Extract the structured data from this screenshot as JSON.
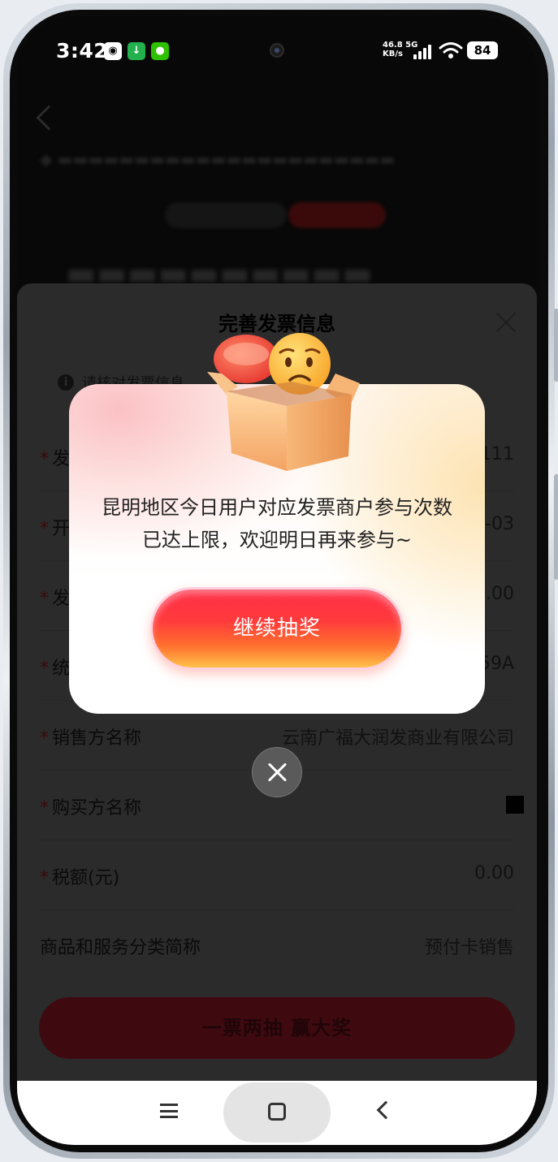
{
  "status_bar": {
    "time": "3:42",
    "speed_value": "46.8",
    "speed_unit": "KB/s",
    "network": "5G",
    "battery": "84"
  },
  "sheet": {
    "title": "完善发票信息",
    "hint": "请核对发票信息",
    "rows": [
      {
        "label": "发",
        "value": "0111",
        "required": true
      },
      {
        "label": "开",
        "value": "-03",
        "required": true
      },
      {
        "label": "发",
        "value": ".00",
        "required": true
      },
      {
        "label": "统",
        "value": "59A",
        "required": true
      },
      {
        "label": "销售方名称",
        "value": "云南广福大润发商业有限公司",
        "required": true
      },
      {
        "label": "购买方名称",
        "value": "",
        "required": true
      },
      {
        "label": "税额(元)",
        "value": "0.00",
        "required": true
      },
      {
        "label": "商品和服务分类简称",
        "value": "预付卡销售",
        "required": false
      }
    ],
    "submit_label": "一票两抽 赢大奖"
  },
  "popup": {
    "message": "昆明地区今日用户对应发票商户参与次数已达上限，欢迎明日再来参与~",
    "button_label": "继续抽奖"
  },
  "colors": {
    "popup_button_top": "#ff2f48",
    "popup_button_bottom": "#ffc24a",
    "overlay": "#2b2b2b",
    "submit_button": "#3e0a0f"
  }
}
